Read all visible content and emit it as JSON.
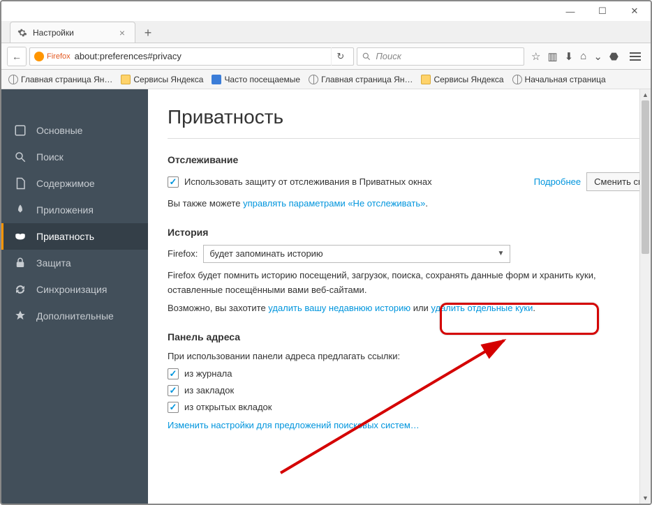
{
  "window": {
    "title": "Настройки"
  },
  "url": {
    "identity": "Firefox",
    "address": "about:preferences#privacy"
  },
  "search": {
    "placeholder": "Поиск"
  },
  "bookmarks": [
    {
      "label": "Главная страница Ян…",
      "icon": "globe"
    },
    {
      "label": "Сервисы Яндекса",
      "icon": "folder"
    },
    {
      "label": "Часто посещаемые",
      "icon": "blue"
    },
    {
      "label": "Главная страница Ян…",
      "icon": "globe"
    },
    {
      "label": "Сервисы Яндекса",
      "icon": "folder"
    },
    {
      "label": "Начальная страница",
      "icon": "globe"
    }
  ],
  "sidebar": {
    "items": [
      {
        "label": "Основные"
      },
      {
        "label": "Поиск"
      },
      {
        "label": "Содержимое"
      },
      {
        "label": "Приложения"
      },
      {
        "label": "Приватность"
      },
      {
        "label": "Защита"
      },
      {
        "label": "Синхронизация"
      },
      {
        "label": "Дополнительные"
      }
    ]
  },
  "page": {
    "title": "Приватность",
    "tracking": {
      "heading": "Отслеживание",
      "checkbox_label": "Использовать защиту от отслеживания в Приватных окнах",
      "learn_more": "Подробнее",
      "change_button": "Сменить сп",
      "also_prefix": "Вы также можете ",
      "also_link": "управлять параметрами «Не отслеживать»",
      "also_suffix": "."
    },
    "history": {
      "heading": "История",
      "label": "Firefox:",
      "select_value": "будет запоминать историю",
      "desc": "Firefox будет помнить историю посещений, загрузок, поиска, сохранять данные форм и хранить куки, оставленные посещёнными вами веб-сайтами.",
      "maybe_prefix": "Возможно, вы захотите ",
      "link1": "удалить вашу недавнюю историю",
      "middle": " или ",
      "link2": "удалить отдельные куки",
      "suffix": "."
    },
    "locbar": {
      "heading": "Панель адреса",
      "intro": "При использовании панели адреса предлагать ссылки:",
      "opt1": "из журнала",
      "opt2": "из закладок",
      "opt3": "из открытых вкладок",
      "change_link": "Изменить настройки для предложений поисковых систем…"
    }
  }
}
